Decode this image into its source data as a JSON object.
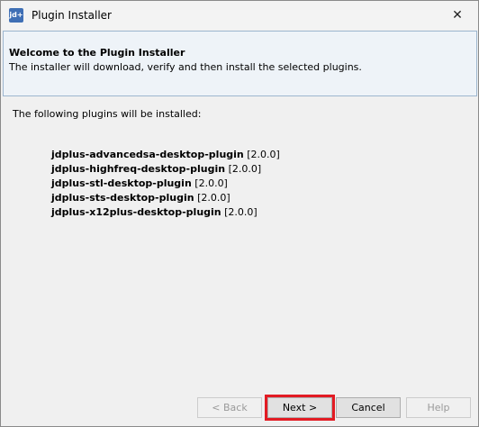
{
  "window": {
    "title": "Plugin Installer",
    "app_icon_text": "jd+",
    "close_glyph": "✕"
  },
  "header": {
    "title": "Welcome to the Plugin Installer",
    "description": "The installer will download, verify and then install the selected plugins."
  },
  "body": {
    "intro": "The following plugins will be installed:",
    "plugins": [
      {
        "name": "jdplus-advancedsa-desktop-plugin",
        "version": "[2.0.0]"
      },
      {
        "name": "jdplus-highfreq-desktop-plugin",
        "version": "[2.0.0]"
      },
      {
        "name": "jdplus-stl-desktop-plugin",
        "version": "[2.0.0]"
      },
      {
        "name": "jdplus-sts-desktop-plugin",
        "version": "[2.0.0]"
      },
      {
        "name": "jdplus-x12plus-desktop-plugin",
        "version": "[2.0.0]"
      }
    ]
  },
  "buttons": {
    "back": "< Back",
    "next": "Next >",
    "cancel": "Cancel",
    "help": "Help"
  },
  "colors": {
    "highlight": "#e21b23",
    "header_bg": "#eef3f8"
  }
}
